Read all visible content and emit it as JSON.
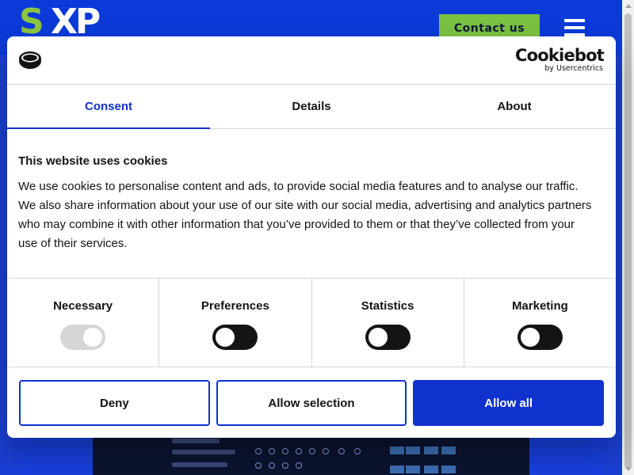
{
  "site": {
    "logo_text": "SXP",
    "contact_label": "Contact us",
    "menu_icon": "hamburger-menu-icon"
  },
  "consent": {
    "brand_name": "Cookiebot",
    "brand_sub": "by Usercentrics",
    "tabs": [
      {
        "label": "Consent",
        "active": true
      },
      {
        "label": "Details",
        "active": false
      },
      {
        "label": "About",
        "active": false
      }
    ],
    "title": "This website uses cookies",
    "body": "We use cookies to personalise content and ads, to provide social media features and to analyse our traffic. We also share information about your use of our site with our social media, advertising and analytics partners who may combine it with other information that you’ve provided to them or that they’ve collected from your use of their services.",
    "categories": [
      {
        "label": "Necessary",
        "state": "on",
        "disabled": true
      },
      {
        "label": "Preferences",
        "state": "off",
        "disabled": false
      },
      {
        "label": "Statistics",
        "state": "off",
        "disabled": false
      },
      {
        "label": "Marketing",
        "state": "off",
        "disabled": false
      }
    ],
    "buttons": {
      "deny": "Deny",
      "allow_selection": "Allow selection",
      "allow_all": "Allow all"
    }
  },
  "colors": {
    "accent": "#1032cf",
    "header_bg": "#0b3ad9",
    "contact_bg": "#7cc242",
    "logo_green": "#8cc63f"
  }
}
